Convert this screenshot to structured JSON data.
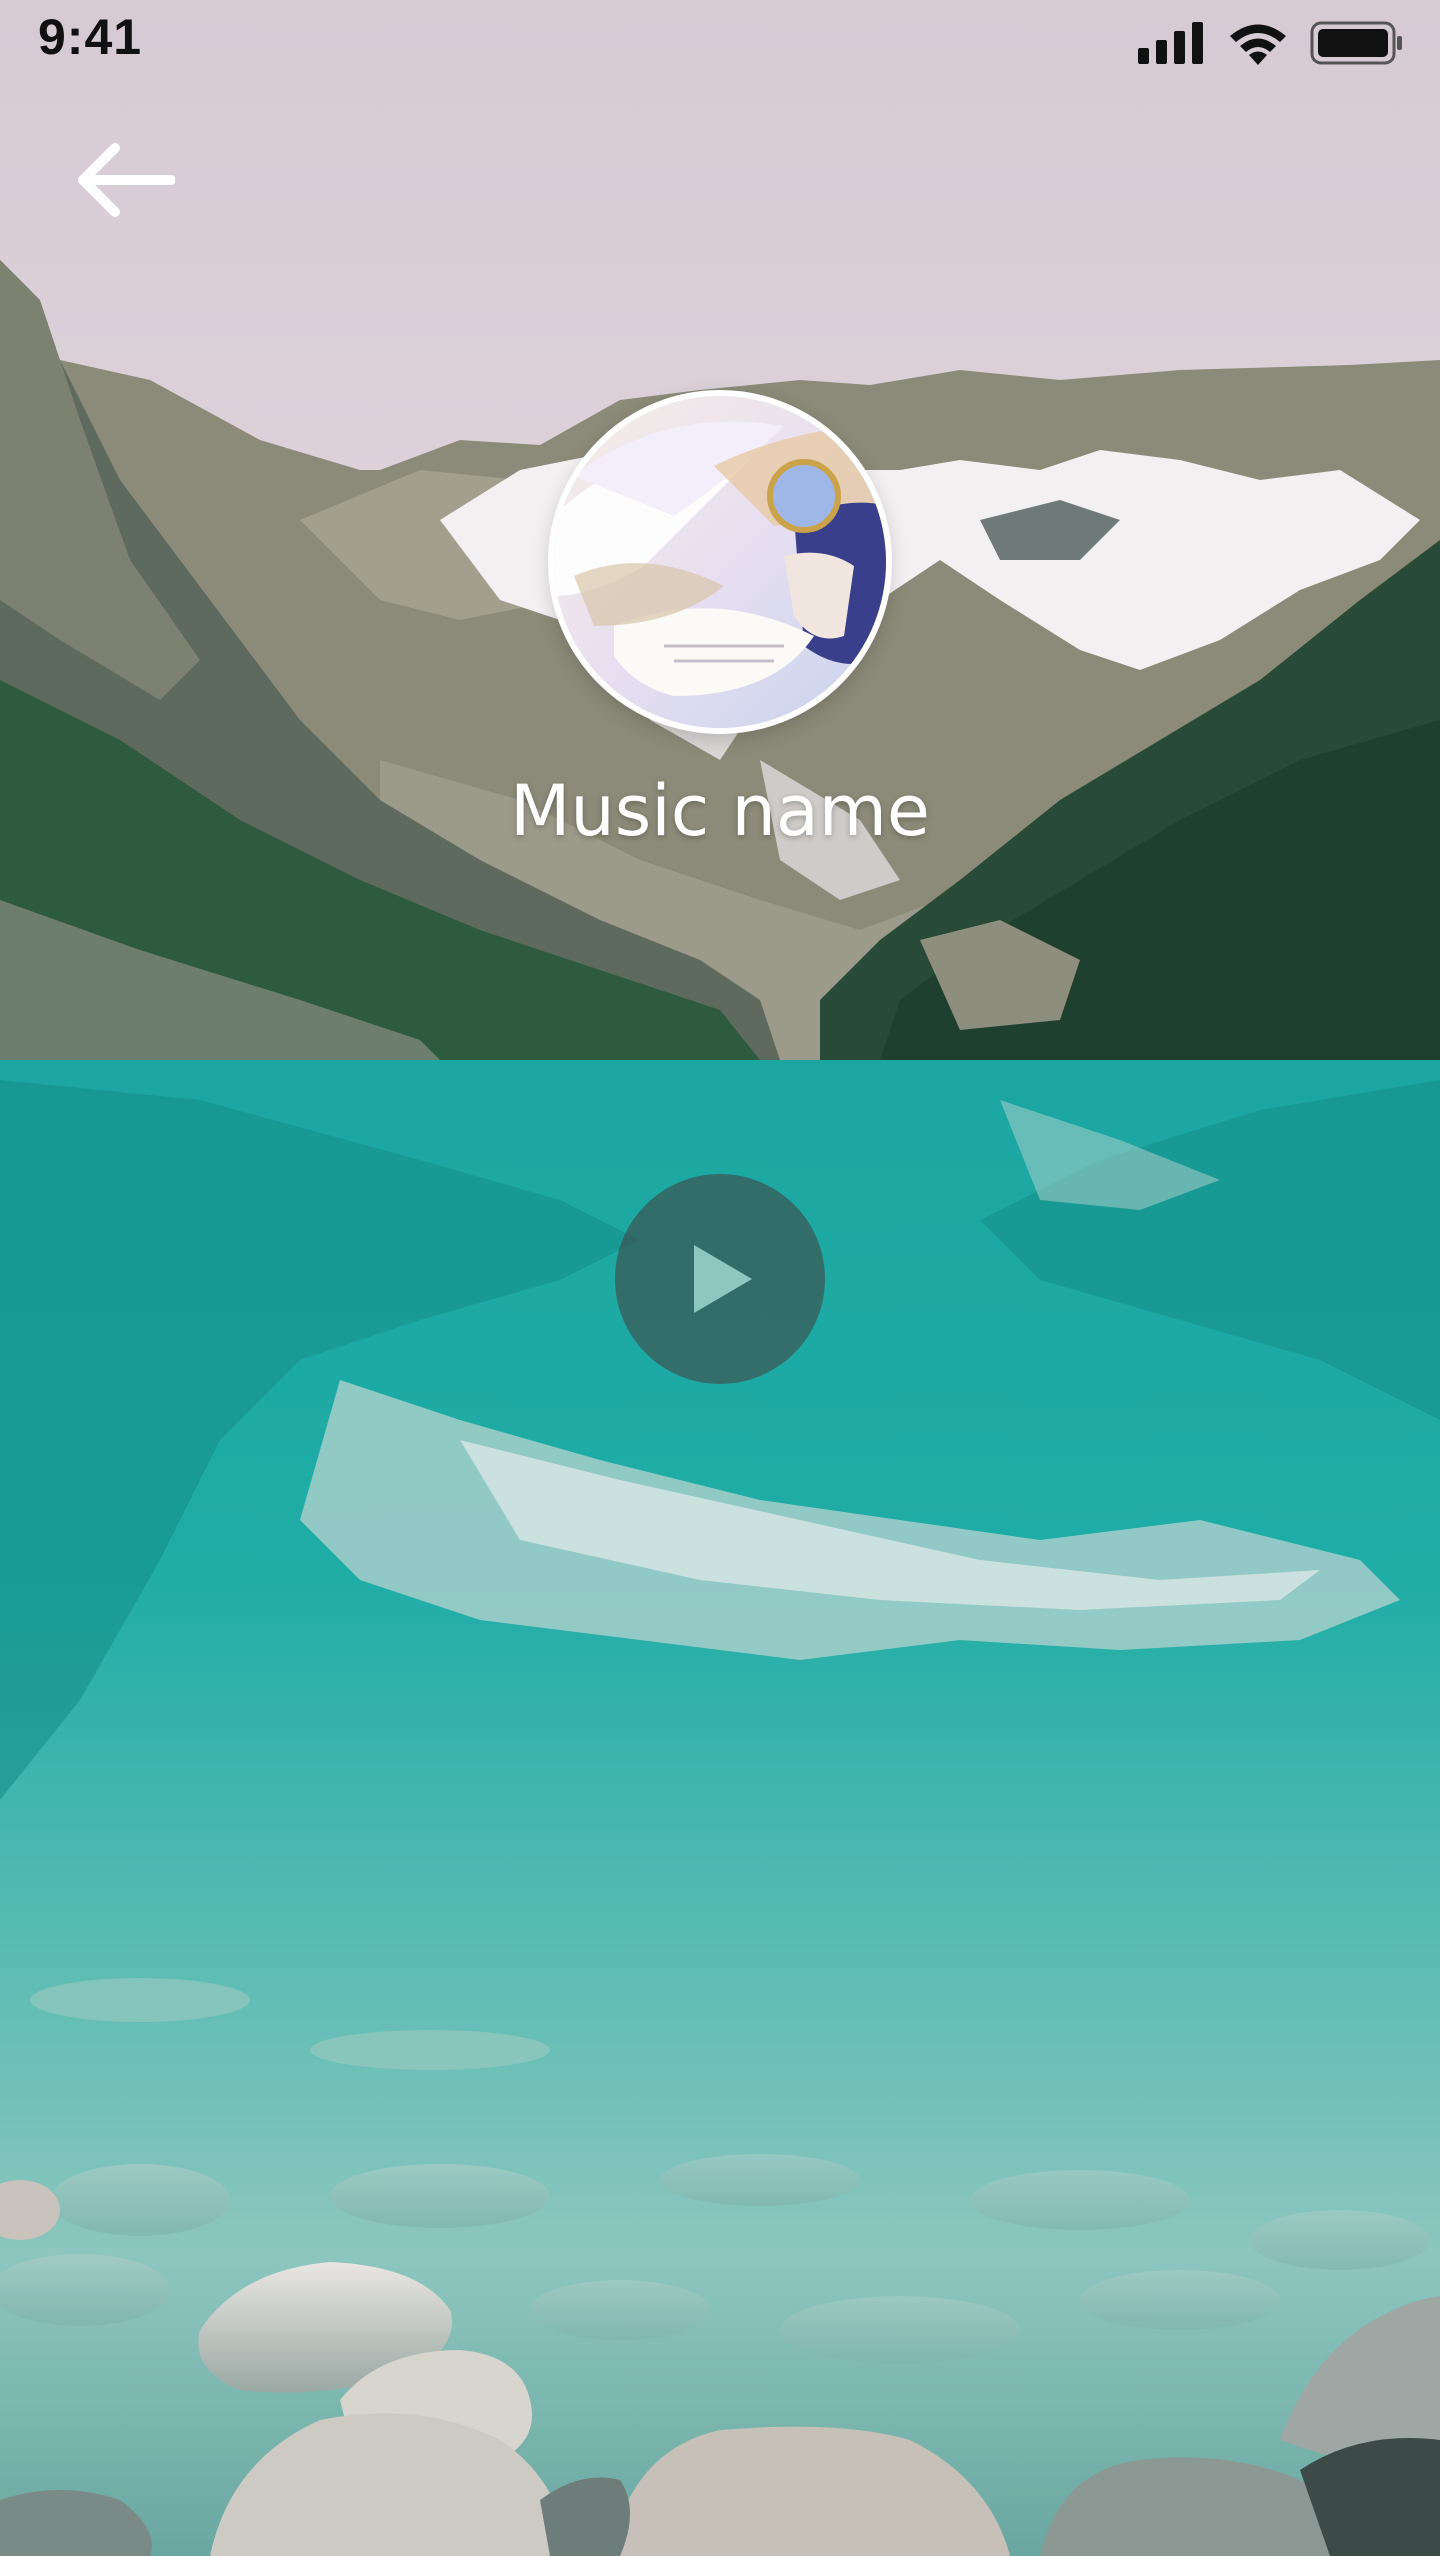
{
  "status_bar": {
    "time": "9:41",
    "icons": [
      "signal-icon",
      "wifi-icon",
      "battery-icon"
    ]
  },
  "header": {
    "back_icon": "arrow-left-icon"
  },
  "player": {
    "title": "Music name",
    "play_icon": "play-icon"
  },
  "colors": {
    "sky": "#ddd2dc",
    "water": "#1fa9a3",
    "text": "#ffffff"
  }
}
